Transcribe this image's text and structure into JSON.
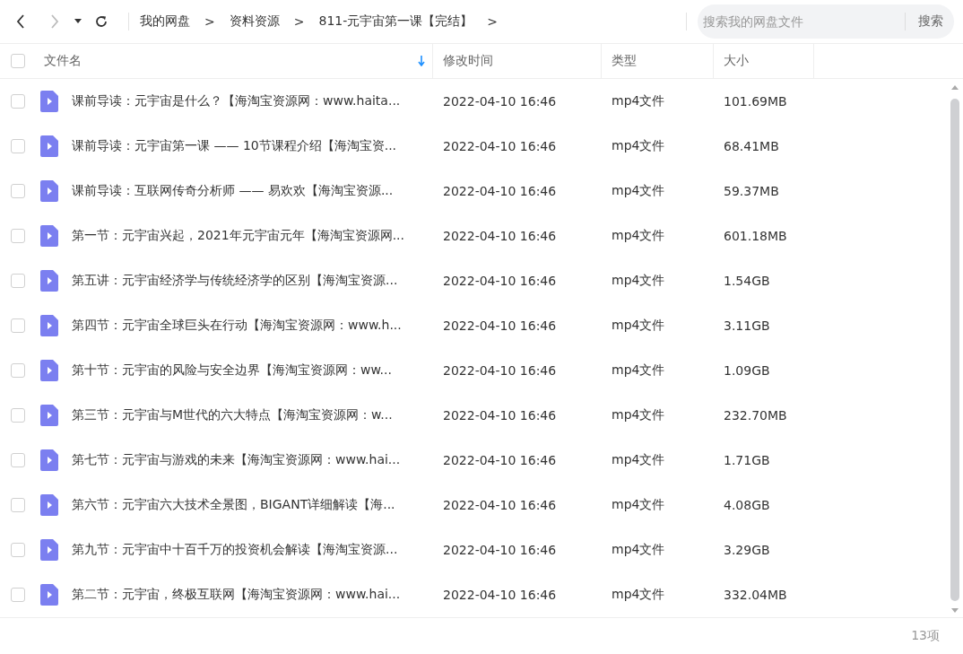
{
  "breadcrumb": [
    {
      "label": "我的网盘"
    },
    {
      "label": "资料资源"
    },
    {
      "label": "811-元宇宙第一课【完结】"
    }
  ],
  "breadcrumb_separator": ">",
  "search": {
    "placeholder": "搜索我的网盘文件",
    "button": "搜索"
  },
  "table": {
    "all_checked": false,
    "columns": [
      "文件名",
      "修改时间",
      "类型",
      "大小"
    ],
    "rows": [
      {
        "name": "课前导读：元宇宙是什么？【海淘宝资源网：www.haita...",
        "modified": "2022-04-10 16:46",
        "type": "mp4文件",
        "size": "101.69MB",
        "checked": false
      },
      {
        "name": "课前导读：元宇宙第一课 —— 10节课程介绍【海淘宝资...",
        "modified": "2022-04-10 16:46",
        "type": "mp4文件",
        "size": "68.41MB",
        "checked": false
      },
      {
        "name": "课前导读：互联网传奇分析师 —— 易欢欢【海淘宝资源...",
        "modified": "2022-04-10 16:46",
        "type": "mp4文件",
        "size": "59.37MB",
        "checked": false
      },
      {
        "name": "第一节：元宇宙兴起，2021年元宇宙元年【海淘宝资源网...",
        "modified": "2022-04-10 16:46",
        "type": "mp4文件",
        "size": "601.18MB",
        "checked": false
      },
      {
        "name": "第五讲：元宇宙经济学与传统经济学的区别【海淘宝资源...",
        "modified": "2022-04-10 16:46",
        "type": "mp4文件",
        "size": "1.54GB",
        "checked": false
      },
      {
        "name": "第四节：元宇宙全球巨头在行动【海淘宝资源网：www.h...",
        "modified": "2022-04-10 16:46",
        "type": "mp4文件",
        "size": "3.11GB",
        "checked": false
      },
      {
        "name": "第十节：元宇宙的风险与安全边界【海淘宝资源网：ww...",
        "modified": "2022-04-10 16:46",
        "type": "mp4文件",
        "size": "1.09GB",
        "checked": false
      },
      {
        "name": "第三节：元宇宙与M世代的六大特点【海淘宝资源网：w...",
        "modified": "2022-04-10 16:46",
        "type": "mp4文件",
        "size": "232.70MB",
        "checked": false
      },
      {
        "name": "第七节：元宇宙与游戏的未来【海淘宝资源网：www.hai...",
        "modified": "2022-04-10 16:46",
        "type": "mp4文件",
        "size": "1.71GB",
        "checked": false
      },
      {
        "name": "第六节：元宇宙六大技术全景图，BIGANT详细解读【海...",
        "modified": "2022-04-10 16:46",
        "type": "mp4文件",
        "size": "4.08GB",
        "checked": false
      },
      {
        "name": "第九节：元宇宙中十百千万的投资机会解读【海淘宝资源...",
        "modified": "2022-04-10 16:46",
        "type": "mp4文件",
        "size": "3.29GB",
        "checked": false
      },
      {
        "name": "第二节：元宇宙，终极互联网【海淘宝资源网：www.hai...",
        "modified": "2022-04-10 16:46",
        "type": "mp4文件",
        "size": "332.04MB",
        "checked": false
      }
    ]
  },
  "status_bar": {
    "count": "13项"
  }
}
